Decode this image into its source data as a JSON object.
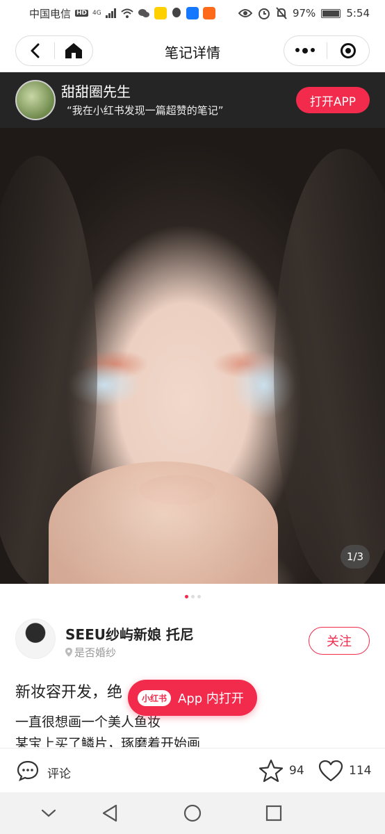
{
  "status_bar": {
    "carrier": "中国电信",
    "network": "4G",
    "battery_percent": "97%",
    "time": "5:54"
  },
  "nav": {
    "title": "笔记详情"
  },
  "banner": {
    "username": "甜甜圈先生",
    "share_text": "“我在小红书发现一篇超赞的笔记”",
    "open_app_label": "打开APP"
  },
  "photo": {
    "page_counter": "1/3"
  },
  "pager": {
    "total": 3,
    "active": 1
  },
  "author": {
    "name": "SEEU纱屿新娘 托尼",
    "location": "是否婚纱",
    "follow_label": "关注"
  },
  "note": {
    "title": "新妆容开发，绝",
    "line1": "一直很想画一个美人鱼妆",
    "line2": "某宝上买了鳞片，琢磨着开始画"
  },
  "floating_button": {
    "logo_text": "小红书",
    "label": "App 内打开"
  },
  "actions": {
    "comment_label": "评论",
    "star_count": "94",
    "like_count": "114"
  },
  "colors": {
    "accent": "#f22a4b",
    "banner_bg": "#282828"
  }
}
